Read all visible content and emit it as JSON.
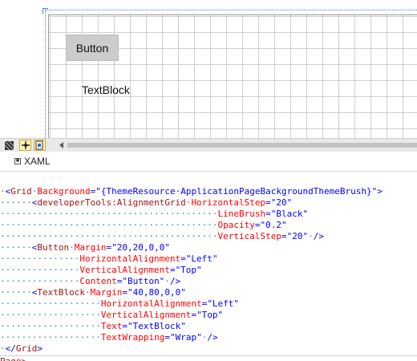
{
  "designer": {
    "button_label": "Button",
    "textblock_label": "TextBlock"
  },
  "toolbar": {
    "icons": [
      "grid-snap-icon",
      "snap-to-lines-icon",
      "effects-icon"
    ]
  },
  "tabs": {
    "xaml_label": "XAML"
  },
  "code": {
    "lines": [
      {
        "indent": "·",
        "parts": [
          [
            "punc",
            "<"
          ],
          [
            "tag",
            "Grid"
          ],
          [
            "ws",
            "·"
          ],
          [
            "attr",
            "Background"
          ],
          [
            "punc",
            "="
          ],
          [
            "val",
            "\"{ThemeResource·ApplicationPageBackgroundThemeBrush}\""
          ],
          [
            "punc",
            ">"
          ]
        ]
      },
      {
        "indent": "······",
        "parts": [
          [
            "punc",
            "<"
          ],
          [
            "tag",
            "developerTools:AlignmentGrid"
          ],
          [
            "ws",
            "·"
          ],
          [
            "attr",
            "HorizontalStep"
          ],
          [
            "punc",
            "="
          ],
          [
            "val",
            "\"20\""
          ]
        ]
      },
      {
        "indent": "·········································",
        "parts": [
          [
            "attr",
            "LineBrush"
          ],
          [
            "punc",
            "="
          ],
          [
            "val",
            "\"Black\""
          ]
        ]
      },
      {
        "indent": "·········································",
        "parts": [
          [
            "attr",
            "Opacity"
          ],
          [
            "punc",
            "="
          ],
          [
            "val",
            "\"0.2\""
          ]
        ]
      },
      {
        "indent": "·········································",
        "parts": [
          [
            "attr",
            "VerticalStep"
          ],
          [
            "punc",
            "="
          ],
          [
            "val",
            "\"20\""
          ],
          [
            "ws",
            "·"
          ],
          [
            "punc",
            "/>"
          ]
        ]
      },
      {
        "indent": "······",
        "parts": [
          [
            "punc",
            "<"
          ],
          [
            "tag",
            "Button"
          ],
          [
            "ws",
            "·"
          ],
          [
            "attr",
            "Margin"
          ],
          [
            "punc",
            "="
          ],
          [
            "val",
            "\"20,20,0,0\""
          ]
        ]
      },
      {
        "indent": "···············",
        "parts": [
          [
            "attr",
            "HorizontalAlignment"
          ],
          [
            "punc",
            "="
          ],
          [
            "val",
            "\"Left\""
          ]
        ]
      },
      {
        "indent": "···············",
        "parts": [
          [
            "attr",
            "VerticalAlignment"
          ],
          [
            "punc",
            "="
          ],
          [
            "val",
            "\"Top\""
          ]
        ]
      },
      {
        "indent": "···············",
        "parts": [
          [
            "attr",
            "Content"
          ],
          [
            "punc",
            "="
          ],
          [
            "val",
            "\"Button\""
          ],
          [
            "ws",
            "·"
          ],
          [
            "punc",
            "/>"
          ]
        ]
      },
      {
        "indent": "······",
        "parts": [
          [
            "punc",
            "<"
          ],
          [
            "tag",
            "TextBlock"
          ],
          [
            "ws",
            "·"
          ],
          [
            "attr",
            "Margin"
          ],
          [
            "punc",
            "="
          ],
          [
            "val",
            "\"40,80,0,0\""
          ]
        ]
      },
      {
        "indent": "···················",
        "parts": [
          [
            "attr",
            "HorizontalAlignment"
          ],
          [
            "punc",
            "="
          ],
          [
            "val",
            "\"Left\""
          ]
        ]
      },
      {
        "indent": "···················",
        "parts": [
          [
            "attr",
            "VerticalAlignment"
          ],
          [
            "punc",
            "="
          ],
          [
            "val",
            "\"Top\""
          ]
        ]
      },
      {
        "indent": "···················",
        "parts": [
          [
            "attr",
            "Text"
          ],
          [
            "punc",
            "="
          ],
          [
            "val",
            "\"TextBlock\""
          ]
        ]
      },
      {
        "indent": "···················",
        "parts": [
          [
            "attr",
            "TextWrapping"
          ],
          [
            "punc",
            "="
          ],
          [
            "val",
            "\"Wrap\""
          ],
          [
            "ws",
            "·"
          ],
          [
            "punc",
            "/>"
          ]
        ]
      },
      {
        "indent": "·",
        "parts": [
          [
            "punc",
            "</"
          ],
          [
            "tag",
            "Grid"
          ],
          [
            "punc",
            ">"
          ]
        ]
      }
    ],
    "trailing_fragment": "Page>"
  },
  "colors": {
    "tag": "#a31515",
    "attribute": "#ff0000",
    "value": "#0000ff",
    "whitespace": "#2b91af",
    "grid_line": "#cfcfcf",
    "guide": "#4a7fd4"
  }
}
